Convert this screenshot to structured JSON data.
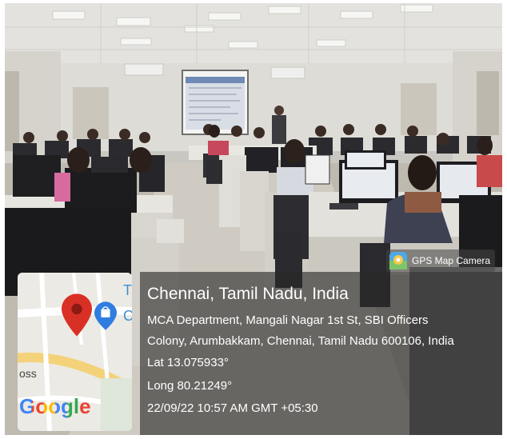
{
  "watermark": {
    "app_name": "GPS Map Camera",
    "place": "Chennai, Tamil Nadu, India",
    "address_line1": "MCA Department, Mangali Nagar 1st St, SBI Officers",
    "address_line2": "Colony, Arumbakkam, Chennai, Tamil Nadu 600106, India",
    "latitude": "Lat 13.075933°",
    "longitude": "Long 80.21249°",
    "datetime": "22/09/22 10:57 AM GMT +05:30"
  },
  "map": {
    "street_text_1": "T",
    "street_text_2": "C",
    "street_text_3": "oss",
    "logo": "Google"
  },
  "colors": {
    "pin_red": "#d93025",
    "shop_pin_blue": "#2f7de1",
    "road_yellow": "#f4d27a"
  }
}
